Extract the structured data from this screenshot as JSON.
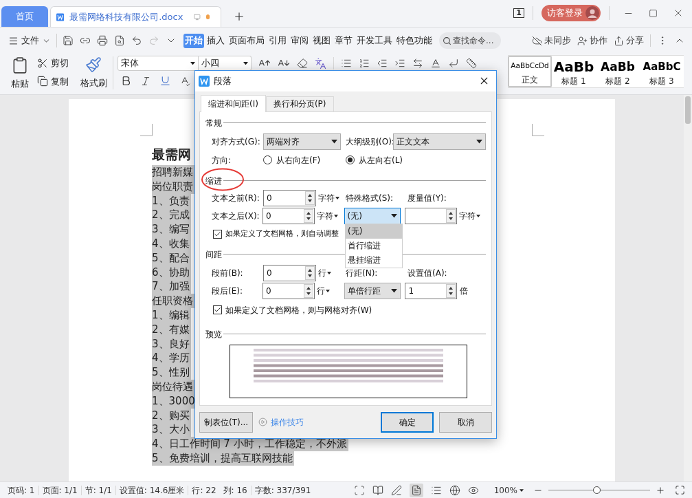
{
  "tabs": [
    {
      "label": "首页",
      "selected": false,
      "kind": "home"
    },
    {
      "label": "最需网络科技有限公司.docx",
      "selected": true,
      "kind": "document",
      "unsaved": true
    }
  ],
  "window_count": "1",
  "account": {
    "label": "访客登录"
  },
  "menu": {
    "file": "文件",
    "ribbon_tabs": [
      {
        "label": "开始",
        "selected": true
      },
      {
        "label": "插入",
        "selected": false
      },
      {
        "label": "页面布局",
        "selected": false
      },
      {
        "label": "引用",
        "selected": false
      },
      {
        "label": "审阅",
        "selected": false
      },
      {
        "label": "视图",
        "selected": false
      },
      {
        "label": "章节",
        "selected": false
      },
      {
        "label": "开发工具",
        "selected": false
      },
      {
        "label": "特色功能",
        "selected": false
      }
    ],
    "search": {
      "placeholder": "查找命令..."
    },
    "actions": [
      {
        "label": "未同步",
        "kind": "sync"
      },
      {
        "label": "协作",
        "kind": "collab"
      },
      {
        "label": "分享",
        "kind": "share"
      }
    ]
  },
  "ribbon": {
    "paste": "粘贴",
    "cut": "剪切",
    "copy": "复制",
    "format_painter": "格式刷",
    "font_family": "宋体",
    "font_size": "小四",
    "styles": [
      {
        "sample": "AaBbCcDd",
        "label": "正文",
        "selected": true,
        "kind": "body"
      },
      {
        "sample": "AaBb",
        "label": "标题 1",
        "selected": false,
        "kind": "h1"
      },
      {
        "sample": "AaBb",
        "label": "标题 2",
        "selected": false,
        "kind": "h2"
      },
      {
        "sample": "AaBbC",
        "label": "标题 3",
        "selected": false,
        "kind": "h3"
      }
    ]
  },
  "document": {
    "heading": "最需网",
    "lines": [
      "招聘新媒",
      "岗位职责",
      "1、负责",
      "2、完成",
      "3、编写",
      "4、收集",
      "5、配合",
      "6、协助",
      "7、加强",
      "任职资格",
      "1、编辑",
      "2、有媒",
      "3、良好",
      "4、学历",
      "5、性别",
      "岗位待遇",
      "1、3000",
      "2、购买",
      "3、大小",
      "4、日工作时间 7 小时，工作稳定，不外派",
      "5、免费培训，提高互联网技能"
    ]
  },
  "dialog": {
    "title": "段落",
    "tabs": [
      {
        "label": "缩进和间距(I)",
        "selected": true
      },
      {
        "label": "换行和分页(P)",
        "selected": false
      }
    ],
    "general": {
      "title": "常规",
      "alignment": {
        "label": "对齐方式(G):",
        "value": "两端对齐"
      },
      "outline": {
        "label": "大纲级别(O):",
        "value": "正文文本"
      },
      "direction": {
        "label": "方向:",
        "options": [
          {
            "label": "从右向左(F)",
            "selected": false
          },
          {
            "label": "从左向右(L)",
            "selected": true
          }
        ]
      }
    },
    "indent": {
      "title": "缩进",
      "before": {
        "label": "文本之前(R):",
        "value": "0",
        "unit": "字符",
        "unit_menu": true
      },
      "after": {
        "label": "文本之后(X):",
        "value": "0",
        "unit": "字符",
        "unit_menu": true
      },
      "special": {
        "label": "特殊格式(S):",
        "value": "(无)",
        "open": true,
        "options": [
          {
            "label": "(无)",
            "selected": true
          },
          {
            "label": "首行缩进",
            "selected": false
          },
          {
            "label": "悬挂缩进",
            "selected": false
          }
        ]
      },
      "amount": {
        "label": "度量值(Y):",
        "unit": "字符",
        "unit_menu": true
      },
      "grid": {
        "label": "如果定义了文档网格，则自动调整",
        "checked": true
      }
    },
    "spacing": {
      "title": "间距",
      "before": {
        "label": "段前(B):",
        "value": "0",
        "unit": "行",
        "unit_menu": true
      },
      "after": {
        "label": "段后(E):",
        "value": "0",
        "unit": "行",
        "unit_menu": true
      },
      "line": {
        "label": "行距(N):",
        "value": "单倍行距",
        "open": false
      },
      "setting": {
        "label": "设置值(A):",
        "value": "1",
        "unit": "倍",
        "unit_menu": false
      },
      "grid": {
        "label": "如果定义了文档网格，则与网格对齐(W)",
        "checked": true
      }
    },
    "preview": {
      "title": "预览"
    },
    "tabs_button": "制表位(T)...",
    "tips_link": "操作技巧",
    "ok": "确定",
    "cancel": "取消"
  },
  "status_bar": {
    "items": [
      "页码: 1",
      "页面: 1/1",
      "节: 1/1",
      "设置值: 14.6厘米",
      "行: 22",
      "列: 16",
      "字数: 337/391"
    ],
    "zoom": "100%",
    "zoom_level": {
      "level": 0.47
    }
  }
}
